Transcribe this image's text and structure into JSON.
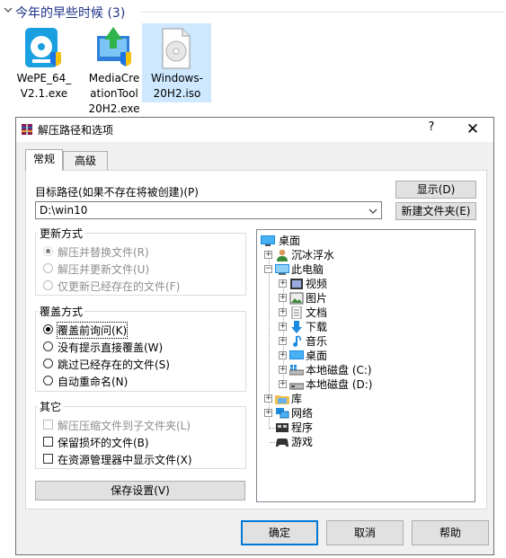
{
  "explorer": {
    "group_title": "今年的早些时候 (3)",
    "files": [
      {
        "name": "WePE_64_\nV2.1.exe",
        "icon": "wepe-disk-icon"
      },
      {
        "name": "MediaCre\nationTool\n20H2.exe",
        "icon": "media-creation-tool-icon"
      },
      {
        "name": "Windows-\n20H2.iso",
        "icon": "iso-disc-icon"
      }
    ]
  },
  "dialog": {
    "title": "解压路径和选项",
    "help_label": "?",
    "close_label": "✕",
    "tabs": [
      "常规",
      "高级"
    ],
    "dest_label": "目标路径(如果不存在将被创建)(P)",
    "dest_value": "D:\\win10",
    "show_button": "显示(D)",
    "new_folder_button": "新建文件夹(E)",
    "update_group": {
      "title": "更新方式",
      "options": [
        "解压并替换文件(R)",
        "解压并更新文件(U)",
        "仅更新已经存在的文件(F)"
      ]
    },
    "overwrite_group": {
      "title": "覆盖方式",
      "options": [
        "覆盖前询问(K)",
        "没有提示直接覆盖(W)",
        "跳过已经存在的文件(S)",
        "自动重命名(N)"
      ]
    },
    "other_group": {
      "title": "其它",
      "options": [
        "解压压缩文件到子文件夹(L)",
        "保留损坏的文件(B)",
        "在资源管理器中显示文件(X)"
      ]
    },
    "save_settings_button": "保存设置(V)",
    "tree": {
      "desktop": "桌面",
      "user": "沉冰浮水",
      "this_pc": "此电脑",
      "videos": "视频",
      "pictures": "图片",
      "documents": "文档",
      "downloads": "下载",
      "music": "音乐",
      "desktop2": "桌面",
      "disk_c": "本地磁盘 (C:)",
      "disk_d": "本地磁盘 (D:)",
      "libraries": "库",
      "network": "网络",
      "programs": "程序",
      "games": "游戏"
    },
    "ok_button": "确定",
    "cancel_button": "取消",
    "help_button": "帮助"
  },
  "colors": {
    "accent": "#0078d7",
    "group_title": "#1e3287",
    "selected_bg": "#cde8ff"
  }
}
